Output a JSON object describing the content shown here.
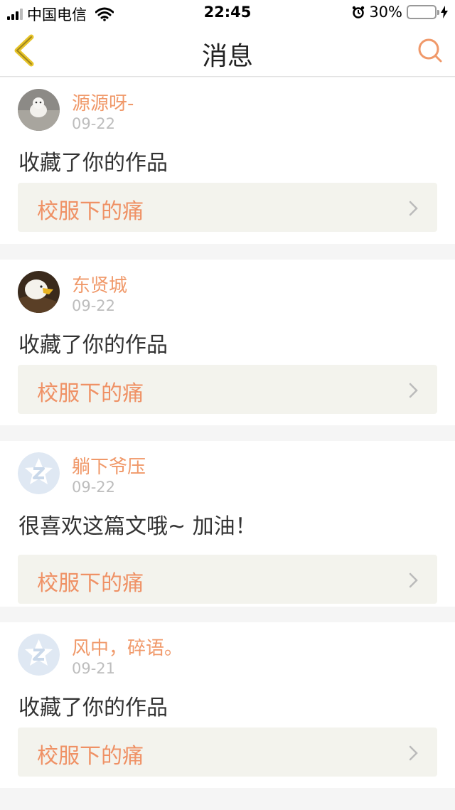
{
  "status_bar": {
    "carrier": "中国电信",
    "time": "22:45",
    "battery": "30%",
    "battery_level": 0.3
  },
  "nav": {
    "title": "消息",
    "back_icon": "chevron-left-icon",
    "search_icon": "search-icon"
  },
  "colors": {
    "accent": "#f0996a",
    "work_bg": "#f3f3ed",
    "date": "#bdbdbd",
    "back_icon": "#e6c329"
  },
  "messages": [
    {
      "username": "源源呀-",
      "date": "09-22",
      "content": "收藏了你的作品",
      "work_title": "校服下的痛",
      "avatar": "dog-avatar"
    },
    {
      "username": "东贤城",
      "date": "09-22",
      "content": "收藏了你的作品",
      "work_title": "校服下的痛",
      "avatar": "eagle-avatar"
    },
    {
      "username": "躺下爷压",
      "date": "09-22",
      "content": "很喜欢这篇文哦~ 加油！",
      "work_title": "校服下的痛",
      "avatar": "default-avatar"
    },
    {
      "username": "风中，碎语。",
      "date": "09-21",
      "content": "收藏了你的作品",
      "work_title": "校服下的痛",
      "avatar": "default-avatar"
    }
  ]
}
